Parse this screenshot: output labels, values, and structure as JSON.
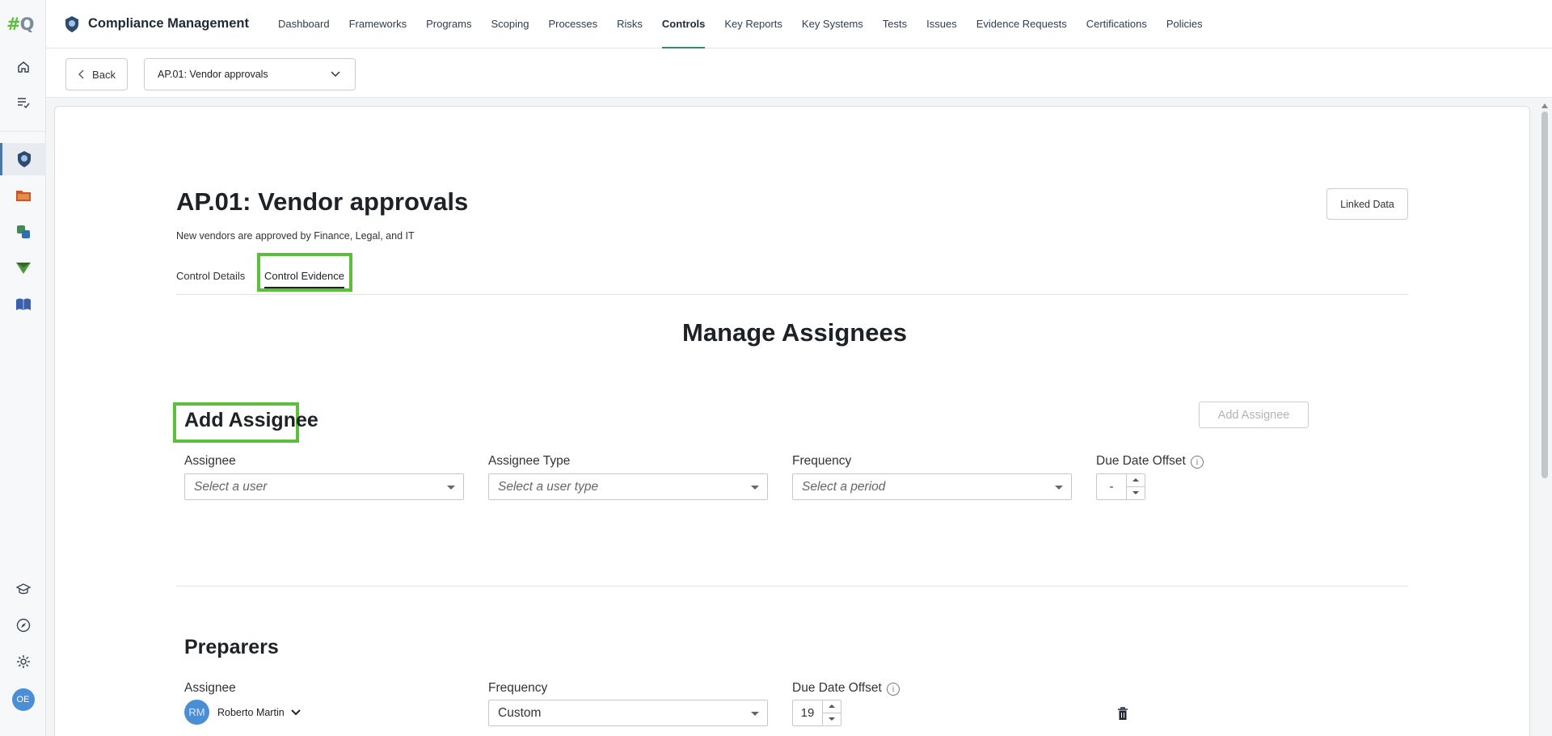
{
  "app": {
    "logo_text_main": "#",
    "logo_text_accent": "Q",
    "title": "Compliance Management",
    "user_initials": "OE"
  },
  "nav": {
    "items": [
      "Dashboard",
      "Frameworks",
      "Programs",
      "Scoping",
      "Processes",
      "Risks",
      "Controls",
      "Key Reports",
      "Key Systems",
      "Tests",
      "Issues",
      "Evidence Requests",
      "Certifications",
      "Policies"
    ],
    "active": "Controls"
  },
  "subbar": {
    "back_label": "Back",
    "control_selected": "AP.01: Vendor approvals"
  },
  "control": {
    "title": "AP.01: Vendor approvals",
    "description": "New vendors are approved by Finance, Legal, and IT",
    "linked_data_label": "Linked Data",
    "tabs": [
      "Control Details",
      "Control Evidence"
    ],
    "active_tab": "Control Evidence"
  },
  "manage": {
    "title": "Manage Assignees",
    "add_section": {
      "title": "Add Assignee",
      "add_button": "Add Assignee",
      "assignee_label": "Assignee",
      "assignee_placeholder": "Select a user",
      "type_label": "Assignee Type",
      "type_placeholder": "Select a user type",
      "frequency_label": "Frequency",
      "frequency_placeholder": "Select a period",
      "offset_label": "Due Date Offset",
      "offset_value": "-"
    },
    "preparers": {
      "title": "Preparers",
      "assignee_label": "Assignee",
      "frequency_label": "Frequency",
      "offset_label": "Due Date Offset",
      "rows": [
        {
          "initials": "RM",
          "name": "Roberto Martin",
          "frequency": "Custom",
          "offset": "19"
        }
      ]
    }
  },
  "colors": {
    "accent": "#2e8b73",
    "highlight": "#5cbf3a",
    "avatar": "#4a8fd6"
  }
}
